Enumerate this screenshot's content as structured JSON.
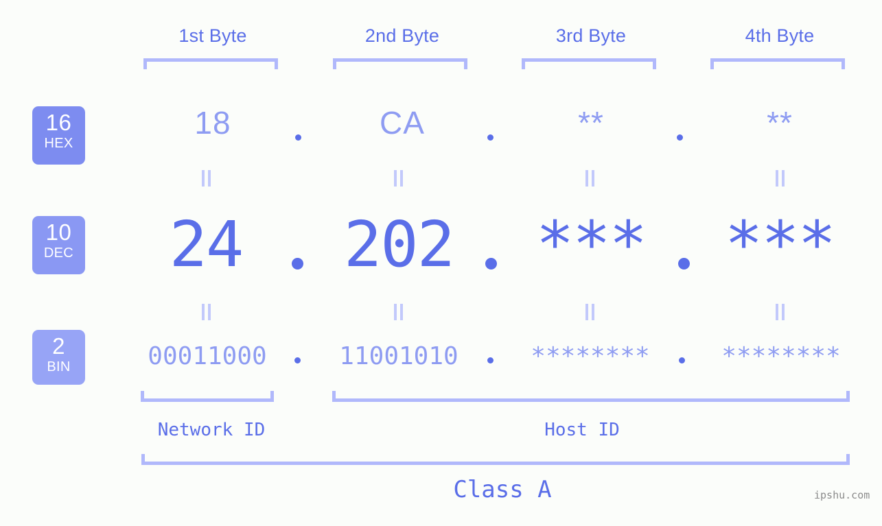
{
  "page": {
    "background_color": "#fbfdfa",
    "accent_dark": "#5a6ee8",
    "accent_light": "#8e9cf2",
    "bracket_color": "#b0b8fb",
    "watermark": "ipshu.com"
  },
  "byte_headers": [
    {
      "label": "1st Byte"
    },
    {
      "label": "2nd Byte"
    },
    {
      "label": "3rd Byte"
    },
    {
      "label": "4th Byte"
    }
  ],
  "bases": [
    {
      "number": "16",
      "system": "HEX",
      "color": "#7d8cf0"
    },
    {
      "number": "10",
      "system": "DEC",
      "color": "#8a98f3"
    },
    {
      "number": "2",
      "system": "BIN",
      "color": "#97a4f6"
    }
  ],
  "rows": {
    "hex": {
      "values": [
        "18",
        "CA",
        "**",
        "**"
      ],
      "separator": "."
    },
    "dec": {
      "values": [
        "24",
        "202",
        "***",
        "***"
      ],
      "separator": "."
    },
    "bin": {
      "values": [
        "00011000",
        "11001010",
        "********",
        "********"
      ],
      "separator": "."
    }
  },
  "sections": [
    {
      "label": "Network ID"
    },
    {
      "label": "Host ID"
    }
  ],
  "class": {
    "label": "Class A"
  }
}
